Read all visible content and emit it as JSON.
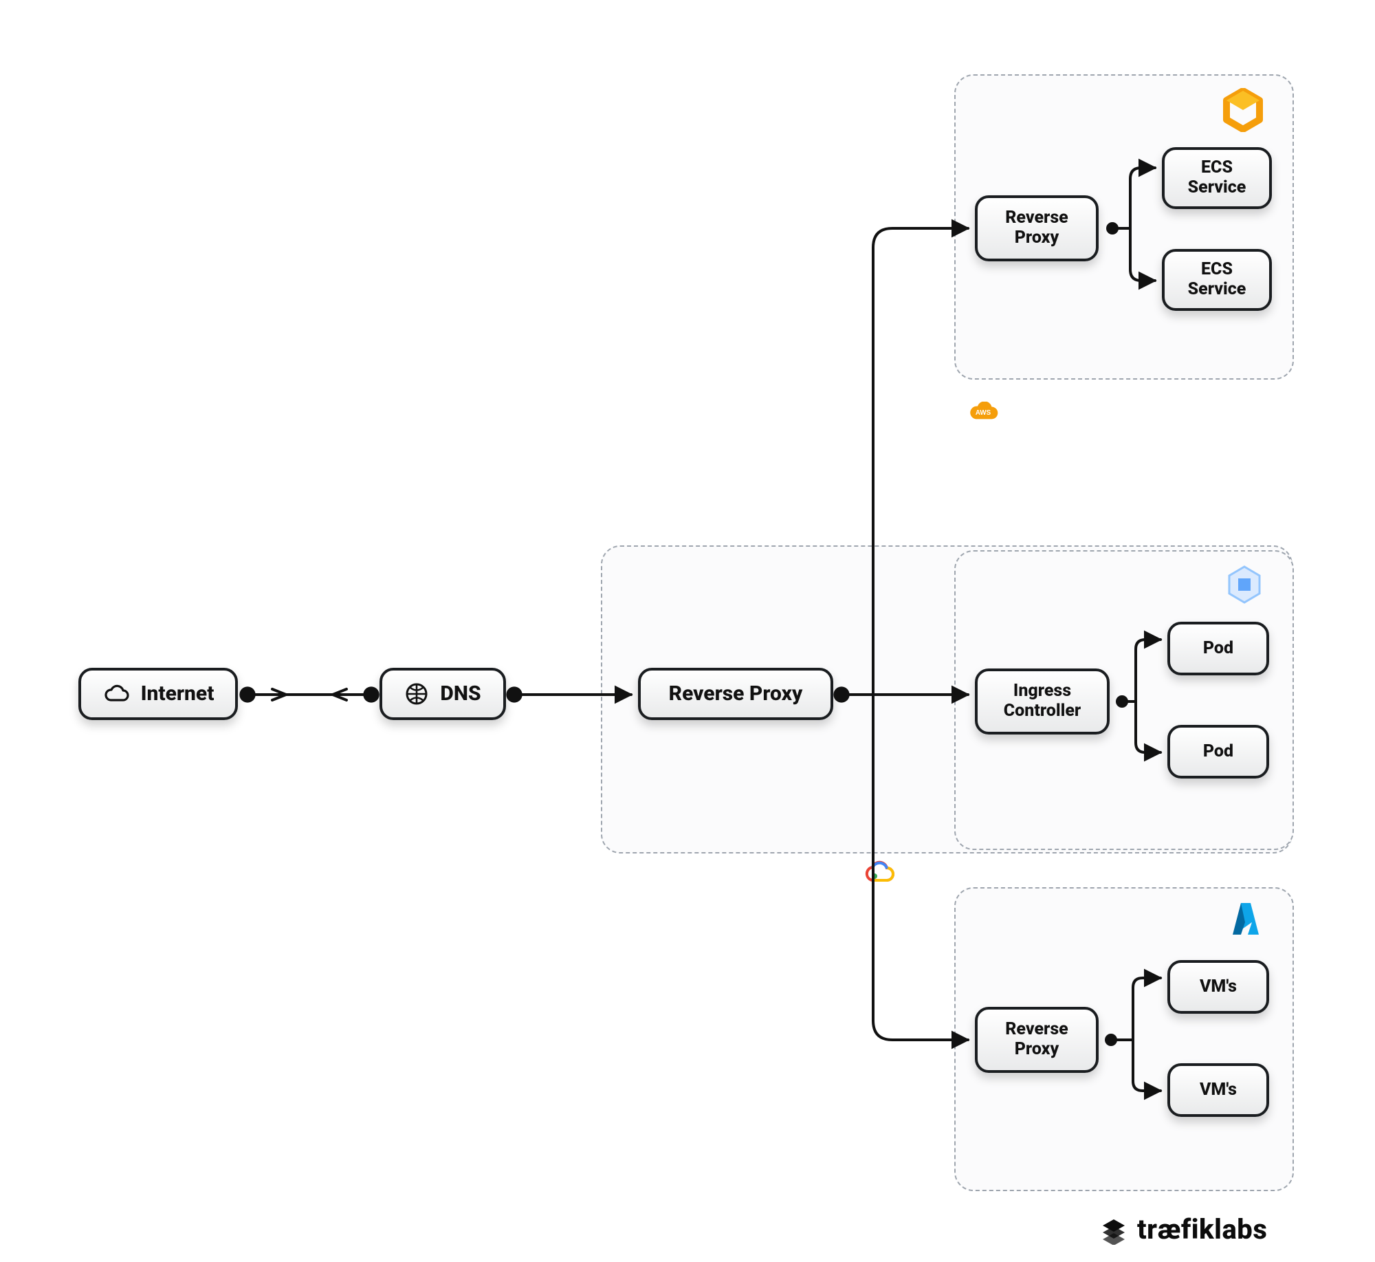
{
  "nodes": {
    "internet": "Internet",
    "dns": "DNS",
    "rproxy_main": "Reverse Proxy",
    "rproxy_ecs": "Reverse\nProxy",
    "ingress": "Ingress\nController",
    "rproxy_vm": "Reverse\nProxy",
    "ecs1": "ECS\nService",
    "ecs2": "ECS\nService",
    "pod1": "Pod",
    "pod2": "Pod",
    "vm1": "VM's",
    "vm2": "VM's"
  },
  "icons": {
    "internet": "cloud-icon",
    "dns": "globe-icon",
    "providers": {
      "aws": "aws",
      "gcp": "gcp",
      "ecs_hex": "ecs-hex",
      "gke_hex": "gke-hex",
      "azure": "azure"
    }
  },
  "brand": "træfiklabs"
}
